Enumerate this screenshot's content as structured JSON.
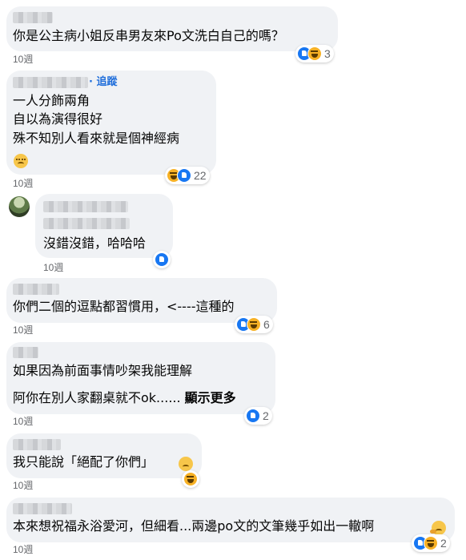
{
  "comments": [
    {
      "lines": [
        "你是公主病小姐反串男友來Po文洗白自己的嗎？"
      ],
      "time": "10週",
      "reactions": {
        "icons": [
          "like-icon",
          "haha-icon"
        ],
        "count": "3"
      }
    },
    {
      "follow": "· 追蹤",
      "lines": [
        "一人分飾兩角",
        "自以為演得很好",
        "殊不知別人看來就是個神經病"
      ],
      "emoji": "relieved-face-emoji",
      "time": "10週",
      "reactions": {
        "icons": [
          "haha-icon",
          "like-icon"
        ],
        "count": "22"
      }
    },
    {
      "lines": [
        "沒錯沒錯，哈哈哈"
      ],
      "time": "10週",
      "reactions": {
        "icons": [
          "like-icon"
        ],
        "count": ""
      }
    },
    {
      "lines": [
        "你們二個的逗點都習慣用，<----這種的"
      ],
      "time": "10週",
      "reactions": {
        "icons": [
          "like-icon",
          "haha-icon"
        ],
        "count": "6"
      }
    },
    {
      "lines": [
        "如果因為前面事情吵架我能理解",
        "阿你在別人家翻桌就不ok......"
      ],
      "see_more": "顯示更多",
      "time": "10週",
      "reactions": {
        "icons": [
          "like-icon"
        ],
        "count": "2"
      }
    },
    {
      "lines": [
        "我只能說「絕配了你們」"
      ],
      "time": "10週",
      "reactions": {
        "icons": [
          "haha-icon"
        ],
        "count": ""
      }
    },
    {
      "lines": [
        "本來想祝福永浴愛河，但細看...兩邊po文的文筆幾乎如出一轍啊"
      ],
      "time": "10週",
      "reactions": {
        "icons": [
          "like-icon",
          "haha-icon"
        ],
        "count": "2"
      }
    }
  ]
}
